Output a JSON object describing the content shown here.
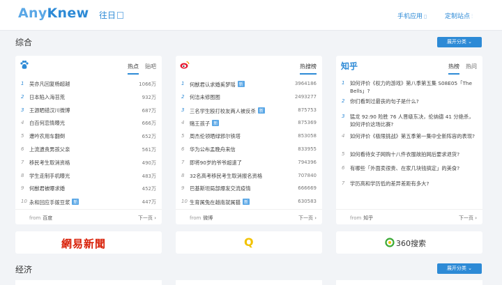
{
  "header": {
    "logo_part1": "Any",
    "logo_part2": "Knew",
    "past_label": "往日",
    "mobile_label": "手机应用",
    "customize_label": "定制站点"
  },
  "sections": [
    {
      "title": "综合",
      "expand_label": "展开分类"
    },
    {
      "title": "经济",
      "expand_label": "展开分类"
    }
  ],
  "baidu": {
    "icon": "baidu-paw-icon",
    "tabs": [
      "热点",
      "贴吧"
    ],
    "active_tab": 0,
    "items": [
      {
        "n": "1",
        "title": "吴亦凡回复杨超越",
        "count": "1066万",
        "new": ""
      },
      {
        "n": "2",
        "title": "日本陷入海苔荒",
        "count": "932万",
        "new": ""
      },
      {
        "n": "3",
        "title": "王源晒错汉川微博",
        "count": "687万",
        "new": ""
      },
      {
        "n": "4",
        "title": "白百何恋情曝光",
        "count": "666万",
        "new": ""
      },
      {
        "n": "5",
        "title": "遭吟农用车翻倒",
        "count": "652万",
        "new": ""
      },
      {
        "n": "6",
        "title": "上流遗责男孩父亲",
        "count": "561万",
        "new": ""
      },
      {
        "n": "7",
        "title": "移民考生取消资格",
        "count": "490万",
        "new": ""
      },
      {
        "n": "8",
        "title": "学生走制手机曝光",
        "count": "483万",
        "new": ""
      },
      {
        "n": "9",
        "title": "何猷君被曝求婚",
        "count": "452万",
        "new": ""
      },
      {
        "n": "10",
        "title": "永和回应手拨豆浆",
        "count": "447万",
        "new": "新"
      }
    ],
    "from_label": "from",
    "source": "百度",
    "more": "下一页"
  },
  "weibo": {
    "icon": "weibo-icon",
    "tabs": [
      "热搜榜"
    ],
    "active_tab": 0,
    "items": [
      {
        "n": "1",
        "title": "何猷君认求婚奚梦瑶",
        "count": "3964186",
        "new": "新"
      },
      {
        "n": "2",
        "title": "何洁未修图图",
        "count": "2493277",
        "new": ""
      },
      {
        "n": "3",
        "title": "三名学生殴打校友两人被反杀",
        "count": "875753",
        "new": "新"
      },
      {
        "n": "4",
        "title": "赌王孩子",
        "count": "875369",
        "new": "新"
      },
      {
        "n": "5",
        "title": "周杰伦领晒绿邪尔铁塔",
        "count": "853058",
        "new": ""
      },
      {
        "n": "6",
        "title": "华为公布孟晚舟来信",
        "count": "833955",
        "new": ""
      },
      {
        "n": "7",
        "title": "即将90岁的爷爷超速了",
        "count": "794396",
        "new": ""
      },
      {
        "n": "8",
        "title": "32名高考移民考生取消报名资格",
        "count": "707840",
        "new": ""
      },
      {
        "n": "9",
        "title": "巴基斯坦局部爆发交流疫情",
        "count": "666669",
        "new": ""
      },
      {
        "n": "10",
        "title": "生育属兔在越南就属猫",
        "count": "630583",
        "new": "新"
      }
    ],
    "from_label": "from",
    "source": "微博",
    "more": "下一页"
  },
  "zhihu": {
    "logo": "知乎",
    "tabs": [
      "热榜",
      "热问"
    ],
    "active_tab": 0,
    "items": [
      {
        "n": "1",
        "title": "如何评价《权力的游戏》第八季第五集 S08E05「The Bells」?"
      },
      {
        "n": "2",
        "title": "你们看到过最丧的句子是什么?"
      },
      {
        "n": "3",
        "title": "猛龙 92:90 险胜 76 人晋级东决，伦纳德 41 分绝杀，如何评价这场比赛?"
      },
      {
        "n": "4",
        "title": "如何评价《极限挑战》第五季第一集中全新阵容的表现?"
      },
      {
        "n": "5",
        "title": "如何看待女子网购十八件衣服故拍网后要求退货?"
      },
      {
        "n": "6",
        "title": "有哪些「外面卖很贵、在家几块钱搞定」的美食?"
      },
      {
        "n": "7",
        "title": "学历高和学历低的差异差距有多大?"
      }
    ],
    "from_label": "from",
    "source": "知乎",
    "more": "下一页"
  },
  "ads": [
    {
      "label": "網易新聞",
      "color": "#d81e06"
    },
    {
      "label": "Q",
      "color": "#f2c200"
    },
    {
      "label": "360搜索",
      "color": "#333333",
      "icon": "360-search-icon"
    }
  ]
}
